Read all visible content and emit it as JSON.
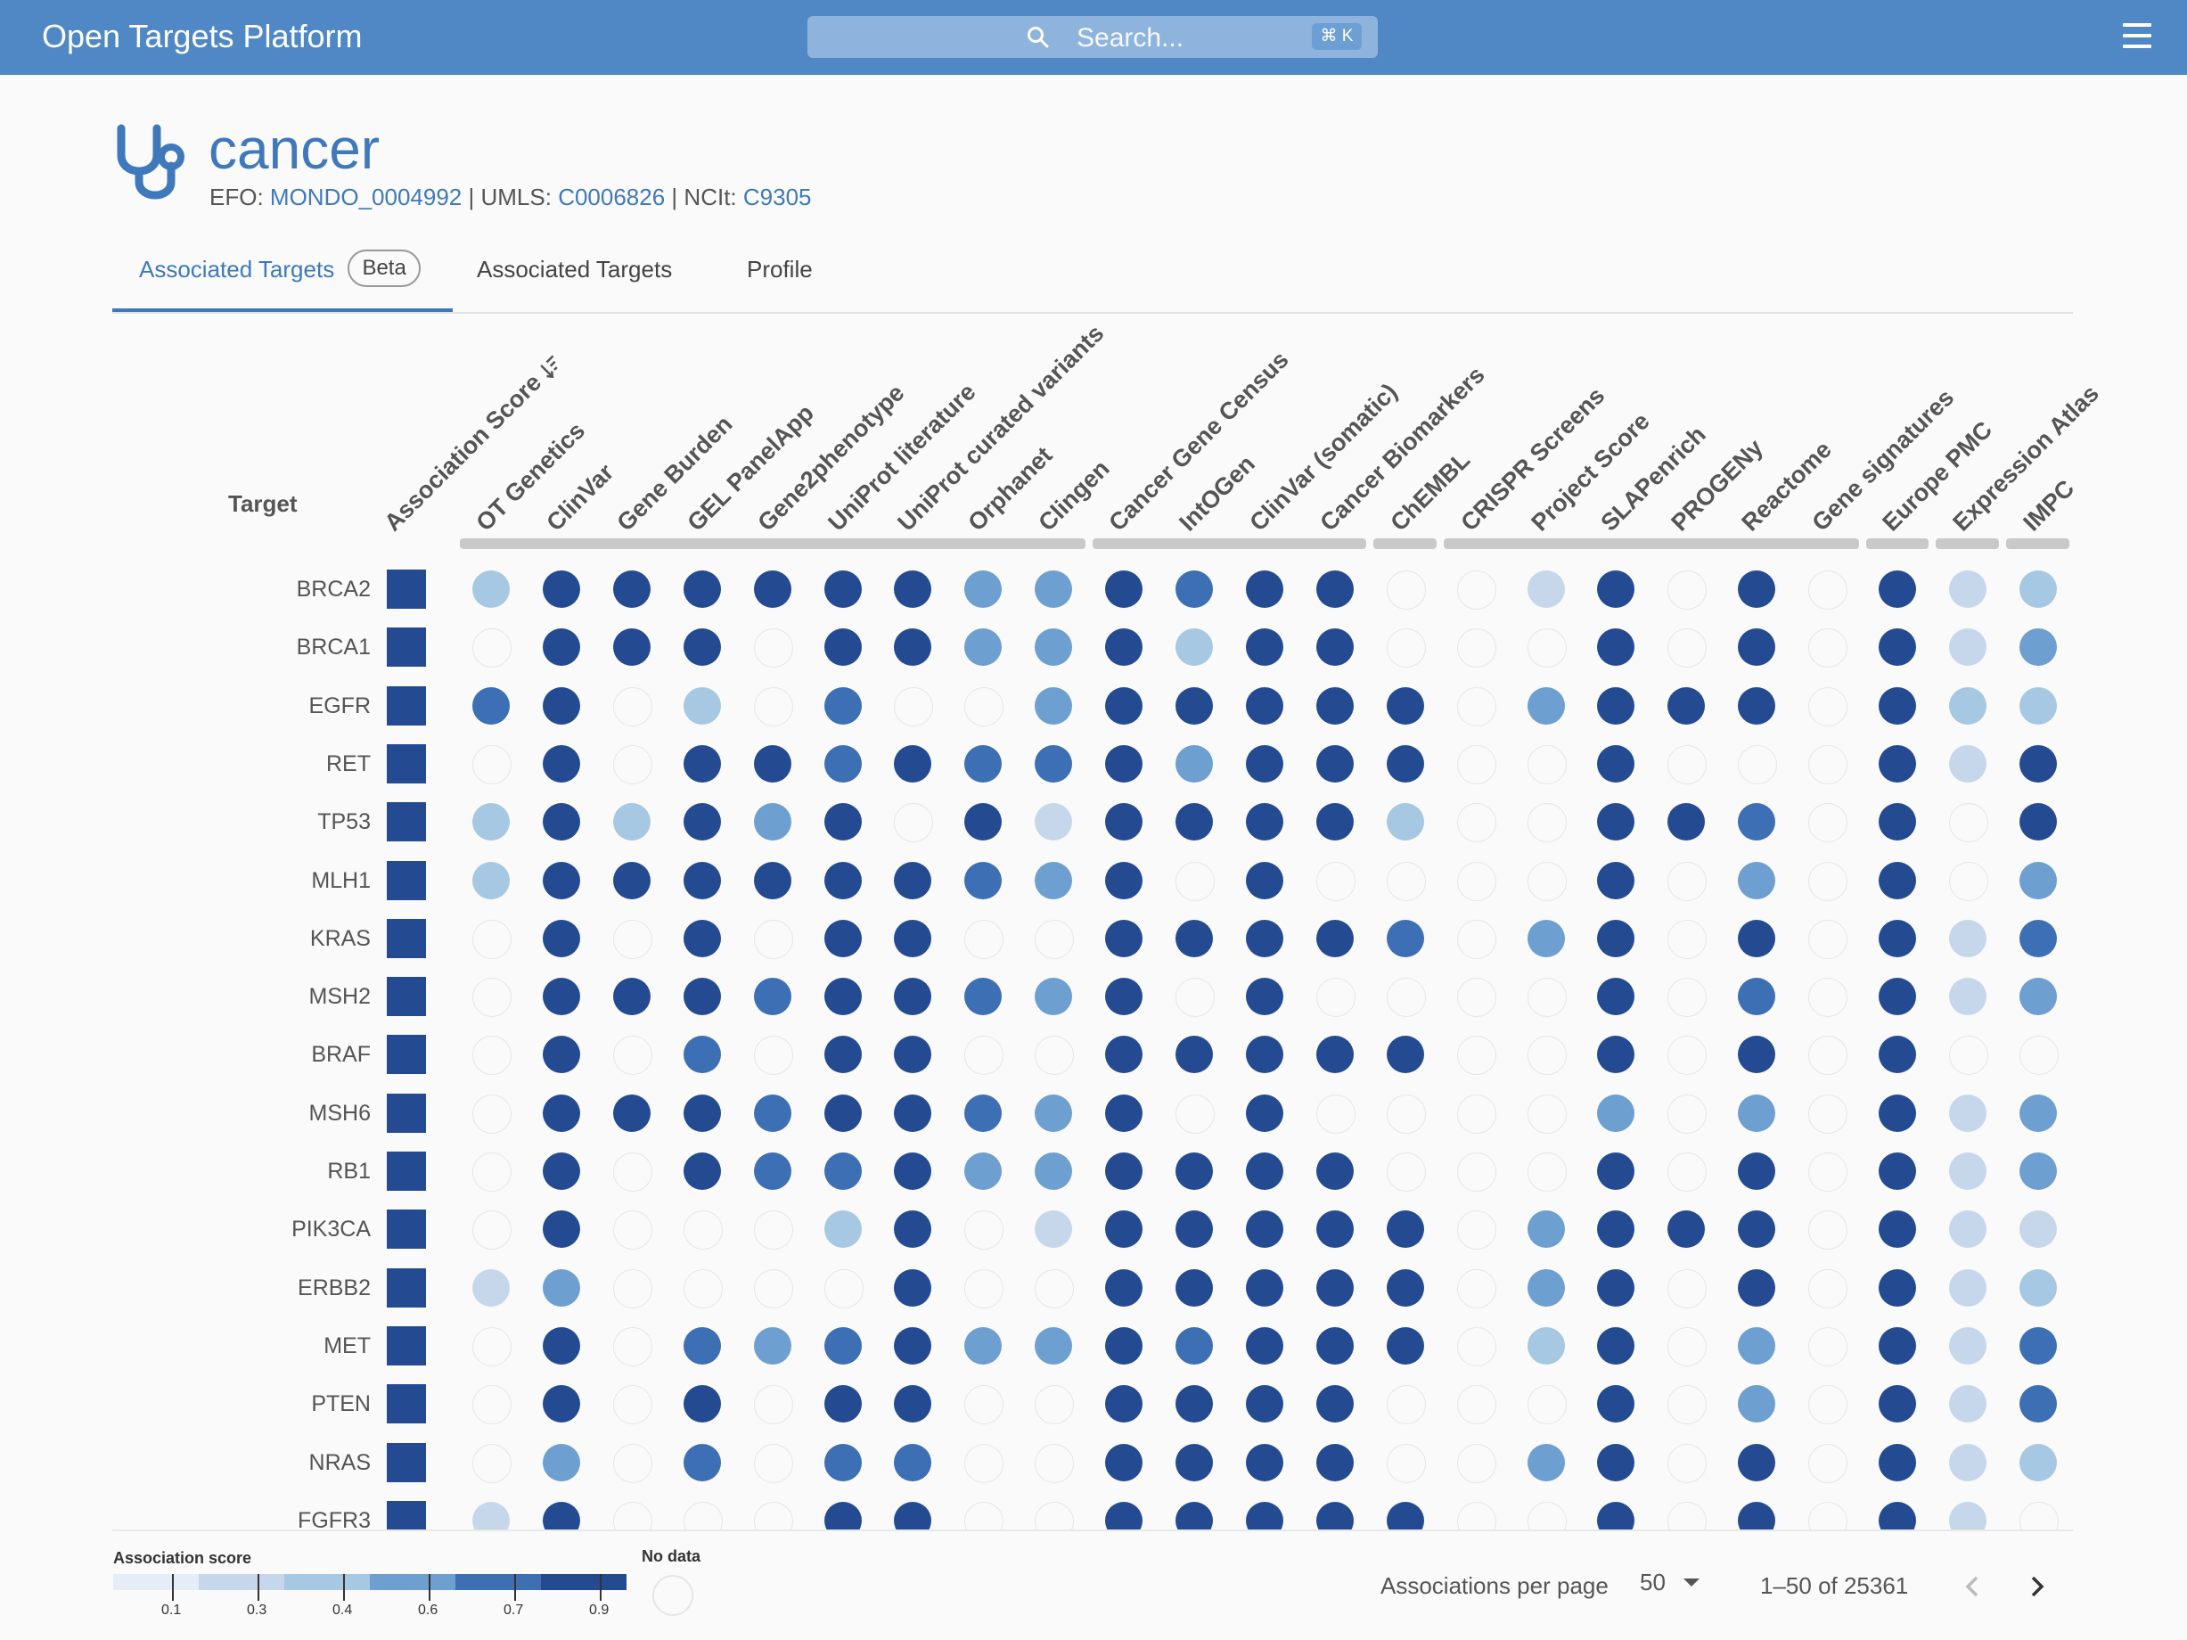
{
  "app": {
    "brand_main": "Open Targets",
    "brand_sub": "Platform",
    "search_placeholder": "Search...",
    "search_shortcut": "⌘ K"
  },
  "disease": {
    "title": "cancer",
    "efo_label": "EFO:",
    "efo_id": "MONDO_0004992",
    "umls_label": "UMLS:",
    "umls_id": "C0006826",
    "ncit_label": "NCIt:",
    "ncit_id": "C9305",
    "icon": "stethoscope-icon"
  },
  "tabs": [
    {
      "label": "Associated Targets",
      "badge": "Beta",
      "active": true
    },
    {
      "label": "Associated Targets",
      "active": false
    },
    {
      "label": "Profile",
      "active": false
    }
  ],
  "grid": {
    "target_header": "Target",
    "score_column": "Association Score",
    "columns": [
      "OT Genetics",
      "ClinVar",
      "Gene Burden",
      "GEL PanelApp",
      "Gene2phenotype",
      "UniProt literature",
      "UniProt curated variants",
      "Orphanet",
      "Clingen",
      "Cancer Gene Census",
      "IntOGen",
      "ClinVar (somatic)",
      "Cancer Biomarkers",
      "ChEMBL",
      "CRISPR Screens",
      "Project Score",
      "SLAPenrich",
      "PROGENy",
      "Reactome",
      "Gene signatures",
      "Europe PMC",
      "Expression Atlas",
      "IMPC"
    ],
    "rows": [
      {
        "target": "BRCA2",
        "scores": [
          2,
          5,
          5,
          5,
          5,
          5,
          5,
          3,
          3,
          5,
          4,
          5,
          5,
          0,
          0,
          1,
          5,
          0,
          5,
          0,
          5,
          1,
          2
        ]
      },
      {
        "target": "BRCA1",
        "scores": [
          0,
          5,
          5,
          5,
          0,
          5,
          5,
          3,
          3,
          5,
          2,
          5,
          5,
          0,
          0,
          0,
          5,
          0,
          5,
          0,
          5,
          1,
          3
        ]
      },
      {
        "target": "EGFR",
        "scores": [
          4,
          5,
          0,
          2,
          0,
          4,
          0,
          0,
          3,
          5,
          5,
          5,
          5,
          5,
          0,
          3,
          5,
          5,
          5,
          0,
          5,
          2,
          2
        ]
      },
      {
        "target": "RET",
        "scores": [
          0,
          5,
          0,
          5,
          5,
          4,
          5,
          4,
          4,
          5,
          3,
          5,
          5,
          5,
          0,
          0,
          5,
          0,
          0,
          0,
          5,
          1,
          5
        ]
      },
      {
        "target": "TP53",
        "scores": [
          2,
          5,
          2,
          5,
          3,
          5,
          0,
          5,
          1,
          5,
          5,
          5,
          5,
          2,
          0,
          0,
          5,
          5,
          4,
          0,
          5,
          0,
          5
        ]
      },
      {
        "target": "MLH1",
        "scores": [
          2,
          5,
          5,
          5,
          5,
          5,
          5,
          4,
          3,
          5,
          0,
          5,
          0,
          0,
          0,
          0,
          5,
          0,
          3,
          0,
          5,
          0,
          3
        ]
      },
      {
        "target": "KRAS",
        "scores": [
          0,
          5,
          0,
          5,
          0,
          5,
          5,
          0,
          0,
          5,
          5,
          5,
          5,
          4,
          0,
          3,
          5,
          0,
          5,
          0,
          5,
          1,
          4
        ]
      },
      {
        "target": "MSH2",
        "scores": [
          0,
          5,
          5,
          5,
          4,
          5,
          5,
          4,
          3,
          5,
          0,
          5,
          0,
          0,
          0,
          0,
          5,
          0,
          4,
          0,
          5,
          1,
          3
        ]
      },
      {
        "target": "BRAF",
        "scores": [
          0,
          5,
          0,
          4,
          0,
          5,
          5,
          0,
          0,
          5,
          5,
          5,
          5,
          5,
          0,
          0,
          5,
          0,
          5,
          0,
          5,
          0,
          0
        ]
      },
      {
        "target": "MSH6",
        "scores": [
          0,
          5,
          5,
          5,
          4,
          5,
          5,
          4,
          3,
          5,
          0,
          5,
          0,
          0,
          0,
          0,
          3,
          0,
          3,
          0,
          5,
          1,
          3
        ]
      },
      {
        "target": "RB1",
        "scores": [
          0,
          5,
          0,
          5,
          4,
          4,
          5,
          3,
          3,
          5,
          5,
          5,
          5,
          0,
          0,
          0,
          5,
          0,
          5,
          0,
          5,
          1,
          3
        ]
      },
      {
        "target": "PIK3CA",
        "scores": [
          0,
          5,
          0,
          0,
          0,
          2,
          5,
          0,
          1,
          5,
          5,
          5,
          5,
          5,
          0,
          3,
          5,
          5,
          5,
          0,
          5,
          1,
          1
        ]
      },
      {
        "target": "ERBB2",
        "scores": [
          1,
          3,
          0,
          0,
          0,
          0,
          5,
          0,
          0,
          5,
          5,
          5,
          5,
          5,
          0,
          3,
          5,
          0,
          5,
          0,
          5,
          1,
          2
        ]
      },
      {
        "target": "MET",
        "scores": [
          0,
          5,
          0,
          4,
          3,
          4,
          5,
          3,
          3,
          5,
          4,
          5,
          5,
          5,
          0,
          2,
          5,
          0,
          3,
          0,
          5,
          1,
          4
        ]
      },
      {
        "target": "PTEN",
        "scores": [
          0,
          5,
          0,
          5,
          0,
          5,
          5,
          0,
          0,
          5,
          5,
          5,
          5,
          0,
          0,
          0,
          5,
          0,
          3,
          0,
          5,
          1,
          4
        ]
      },
      {
        "target": "NRAS",
        "scores": [
          0,
          3,
          0,
          4,
          0,
          4,
          4,
          0,
          0,
          5,
          5,
          5,
          5,
          0,
          0,
          3,
          5,
          0,
          5,
          0,
          5,
          1,
          2
        ]
      },
      {
        "target": "FGFR3",
        "scores": [
          1,
          5,
          0,
          0,
          0,
          5,
          5,
          0,
          0,
          5,
          5,
          5,
          5,
          5,
          0,
          0,
          5,
          0,
          5,
          0,
          5,
          1,
          0
        ]
      }
    ]
  },
  "legend": {
    "title": "Association score",
    "ticks": [
      "0.1",
      "0.3",
      "0.4",
      "0.6",
      "0.7",
      "0.9"
    ],
    "nodata_title": "No data"
  },
  "pagination": {
    "per_page_label": "Associations per page",
    "per_page_value": "50",
    "range": "1–50 of 25361"
  },
  "colors": {
    "brand": "#4f88c4",
    "accent": "#3f79bc",
    "scale": [
      "#e4edf8",
      "#c6d7ec",
      "#a6c8e2",
      "#6d9fd0",
      "#3d6fb4",
      "#244b92"
    ]
  }
}
